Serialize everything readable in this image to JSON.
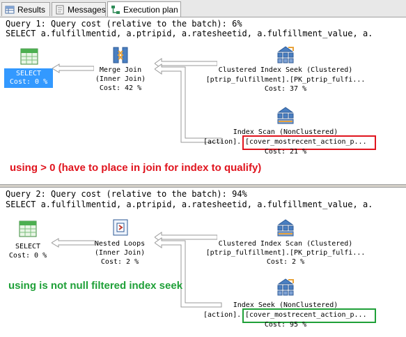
{
  "tabs": [
    {
      "label": "Results",
      "icon": "grid-icon"
    },
    {
      "label": "Messages",
      "icon": "messages-icon"
    },
    {
      "label": "Execution plan",
      "icon": "execution-plan-icon"
    }
  ],
  "query1": {
    "header_line1": "Query 1: Query cost (relative to the batch): 6%",
    "header_line2": "SELECT a.fulfillmentid, a.ptripid, a.ratesheetid, a.fulfillment_value, a.",
    "select": {
      "label": "SELECT",
      "cost": "Cost: 0 %"
    },
    "merge_join": {
      "label": "Merge Join",
      "sub": "(Inner Join)",
      "cost": "Cost: 42 %"
    },
    "seek": {
      "label": "Clustered Index Seek (Clustered)",
      "object": "[ptrip_fulfillment].[PK_ptrip_fulfi...",
      "cost": "Cost: 37 %"
    },
    "scan": {
      "label": "Index Scan (NonClustered)",
      "object_prefix": "[action].",
      "object_index": "[cover_mostrecent_action_p...",
      "cost": "Cost: 21 %"
    },
    "annotation": "using > 0 (have to place in join for index to qualify)",
    "annotation_color": "#e0141e"
  },
  "query2": {
    "header_line1": "Query 2: Query cost (relative to the batch): 94%",
    "header_line2": "SELECT a.fulfillmentid, a.ptripid, a.ratesheetid, a.fulfillment_value, a.",
    "select": {
      "label": "SELECT",
      "cost": "Cost: 0 %"
    },
    "nested_loops": {
      "label": "Nested Loops",
      "sub": "(Inner Join)",
      "cost": "Cost: 2 %"
    },
    "scan": {
      "label": "Clustered Index Scan (Clustered)",
      "object": "[ptrip_fulfillment].[PK_ptrip_fulfi...",
      "cost": "Cost: 2 %"
    },
    "seek": {
      "label": "Index Seek (NonClustered)",
      "object_prefix": "[action].",
      "object_index": "[cover_mostrecent_action_p...",
      "cost": "Cost: 95 %"
    },
    "annotation": "using is not null filtered index seek",
    "annotation_color": "#1fa038"
  },
  "colors": {
    "selected": "#3399ff",
    "highlight_red": "#e0141e",
    "highlight_green": "#1fa038"
  }
}
